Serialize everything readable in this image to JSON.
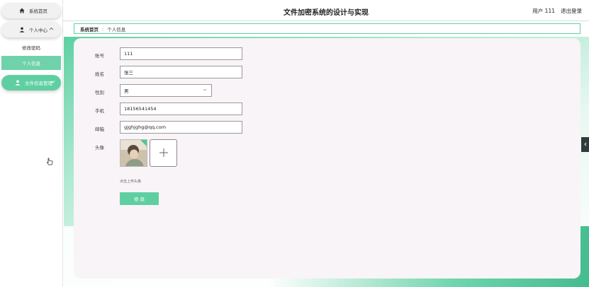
{
  "app": {
    "title": "文件加密系统的设计与实现"
  },
  "header": {
    "user_label": "用户 111",
    "logout_label": "退出登录"
  },
  "sidebar": {
    "home_label": "系统首页",
    "personal_center_label": "个人中心",
    "change_password_label": "修改密码",
    "personal_info_label": "个人信息",
    "file_encryption_label": "文件信息管理"
  },
  "breadcrumb": {
    "home": "系统首页",
    "separator": ":",
    "current": "个人信息"
  },
  "form": {
    "account_label": "账号",
    "account_value": "111",
    "name_label": "姓名",
    "name_value": "张三",
    "gender_label": "性别",
    "gender_value": "男",
    "phone_label": "手机",
    "phone_value": "18156541454",
    "email_label": "邮箱",
    "email_value": "gjghjghg@qq.com",
    "avatar_label": "头像",
    "upload_hint": "点击上传头像",
    "submit_label": "修 改"
  },
  "icons": {
    "home": "home-icon",
    "user": "user-icon",
    "chevron_up": "chevron-up-icon",
    "chevron_down": "chevron-down-icon",
    "plus": "plus-icon",
    "collapse": "chevron-left-icon"
  },
  "colors": {
    "accent": "#5fcfa2",
    "card_bg": "#f8f4f7"
  }
}
